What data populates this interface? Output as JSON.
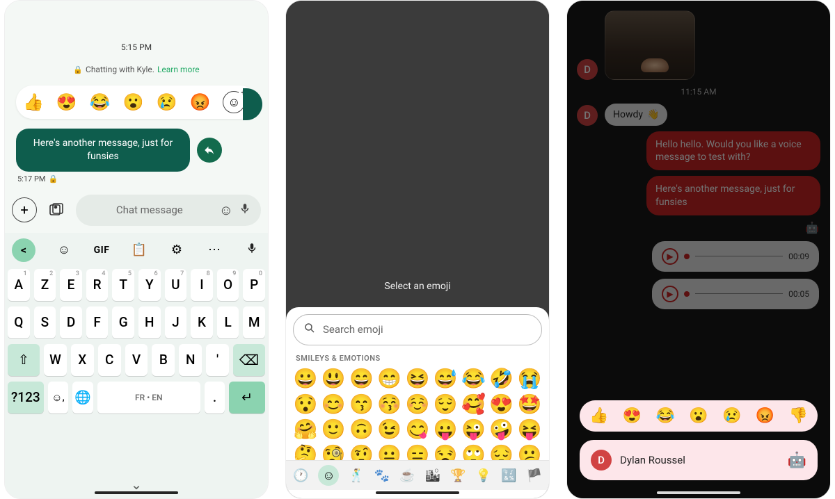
{
  "screen1": {
    "timestamp_top": "5:15 PM",
    "chat_notice_prefix": "Chatting with Kyle.",
    "chat_notice_link": "Learn more",
    "reactions": [
      "👍",
      "😍",
      "😂",
      "😮",
      "😢",
      "😡"
    ],
    "message_bubble": "Here's another message, just for funsies",
    "message_ts": "5:17 PM",
    "compose_placeholder": "Chat message",
    "keyboard": {
      "toolbar_gif": "GIF",
      "row1": [
        [
          "A",
          "1"
        ],
        [
          "Z",
          "2"
        ],
        [
          "E",
          "3"
        ],
        [
          "R",
          "4"
        ],
        [
          "T",
          "5"
        ],
        [
          "Y",
          "6"
        ],
        [
          "U",
          "7"
        ],
        [
          "I",
          "8"
        ],
        [
          "O",
          "9"
        ],
        [
          "P",
          "0"
        ]
      ],
      "row2": [
        "Q",
        "S",
        "D",
        "F",
        "G",
        "H",
        "J",
        "K",
        "L",
        "M"
      ],
      "row3": [
        "W",
        "X",
        "C",
        "V",
        "B",
        "N",
        "'"
      ],
      "numkey": "?123",
      "lang": "FR • EN"
    }
  },
  "screen2": {
    "prompt": "Select an emoji",
    "search_placeholder": "Search emoji",
    "category_label": "SMILEYS & EMOTIONS",
    "rows": [
      [
        "😀",
        "😃",
        "😄",
        "😁",
        "😆",
        "😅",
        "😂",
        "🤣",
        "😭"
      ],
      [
        "😯",
        "😊",
        "😙",
        "😚",
        "☺️",
        "😌",
        "🥰",
        "😍",
        "🤩"
      ],
      [
        "🤗",
        "🙂",
        "🙃",
        "😉",
        "😋",
        "😛",
        "😜",
        "🤪",
        "😝"
      ],
      [
        "🤔",
        "🧐",
        "🤨",
        "😐",
        "😑",
        "😒",
        "🙄",
        "😔",
        "😕"
      ]
    ]
  },
  "screen3": {
    "timestamp": "11:15 AM",
    "avatar_letter": "D",
    "incoming_text": "Howdy",
    "incoming_emoji": "👋",
    "out1": "Hello hello. Would you like a voice message to test with?",
    "out2": "Here's another message, just for funsies",
    "voice1_dur": "00:09",
    "voice2_dur": "00:05",
    "reactions": [
      "👍",
      "😍",
      "😂",
      "😮",
      "😢",
      "😡",
      "👎"
    ],
    "person_name": "Dylan Roussel"
  }
}
